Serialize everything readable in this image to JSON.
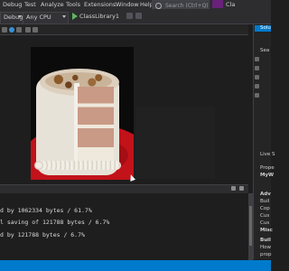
{
  "menubar": {
    "items": [
      "Debug",
      "Test",
      "Analyze",
      "Tools",
      "Extensions",
      "Window",
      "Help"
    ],
    "search_placeholder": "Search (Ctrl+Q)",
    "solution_name": "Cla"
  },
  "toolbar": {
    "configuration": "Debug",
    "platform": "Any CPU",
    "run_target": "ClassLibrary1"
  },
  "editor": {
    "image_subject": "layered cake on red plate"
  },
  "output": {
    "lines": [
      "d by 1062334 bytes / 61.7%",
      "l saving of 121788 bytes / 6.7%",
      "d by 121788 bytes / 6.7%"
    ]
  },
  "right_panel": {
    "items": [
      "Solu",
      "Sea",
      "Live S",
      "Prope",
      "MyW",
      "Adv",
      "Buil",
      "Cop",
      "Cus",
      "Cus",
      "Misc",
      "Buil",
      "How",
      "prop"
    ]
  },
  "colors": {
    "accent": "#007acc",
    "background": "#1e1e1e",
    "chrome": "#2d2d30",
    "plate": "#c2121a"
  }
}
